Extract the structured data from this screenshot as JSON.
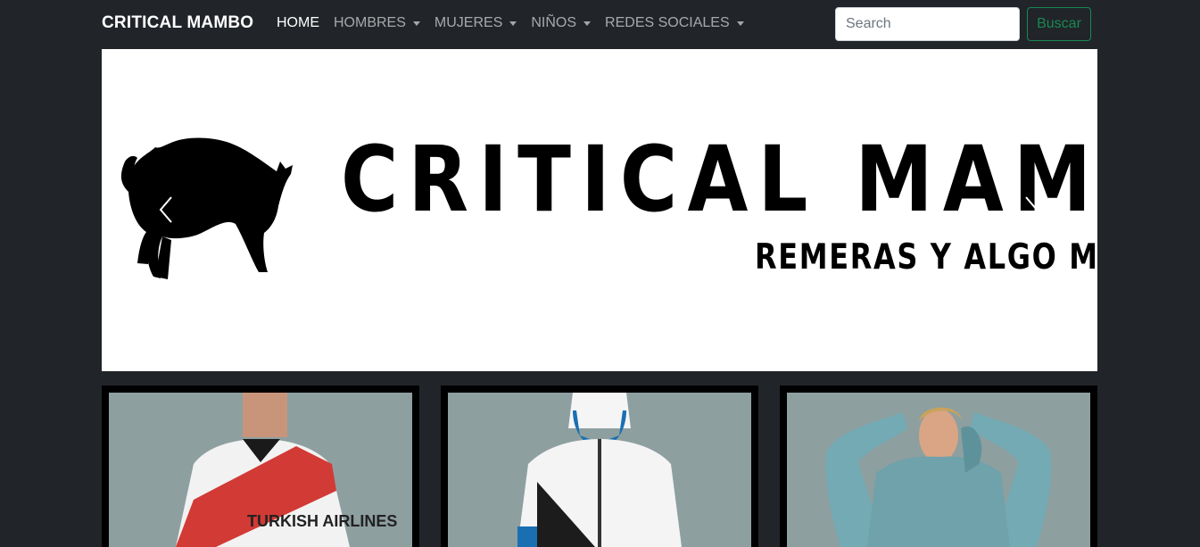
{
  "navbar": {
    "brand": "CRITICAL MAMBO",
    "links": [
      {
        "label": "HOME",
        "active": true,
        "dropdown": false
      },
      {
        "label": "HOMBRES",
        "active": false,
        "dropdown": true
      },
      {
        "label": "MUJERES",
        "active": false,
        "dropdown": true
      },
      {
        "label": "NIÑOS",
        "active": false,
        "dropdown": true
      },
      {
        "label": "REDES SOCIALES",
        "active": false,
        "dropdown": true
      }
    ],
    "search": {
      "placeholder": "Search",
      "value": ""
    },
    "search_button": "Buscar"
  },
  "carousel": {
    "banner_title": "CRITICAL MAMBO",
    "banner_subtitle": "REMERAS Y ALGO MÁS",
    "logo_icon": "black-cat-icon",
    "controls": {
      "prev_icon": "chevron-left-icon",
      "next_icon": "chevron-right-icon"
    }
  },
  "products": [
    {
      "image": "man-river-plate-jersey",
      "jersey_text": "TURKISH AIRLINES"
    },
    {
      "image": "man-white-adidas-jacket"
    },
    {
      "image": "woman-teal-hoodie"
    }
  ],
  "colors": {
    "navbar_bg": "#212529",
    "accent_success": "#198754",
    "card_bg": "#8e9fa0"
  }
}
